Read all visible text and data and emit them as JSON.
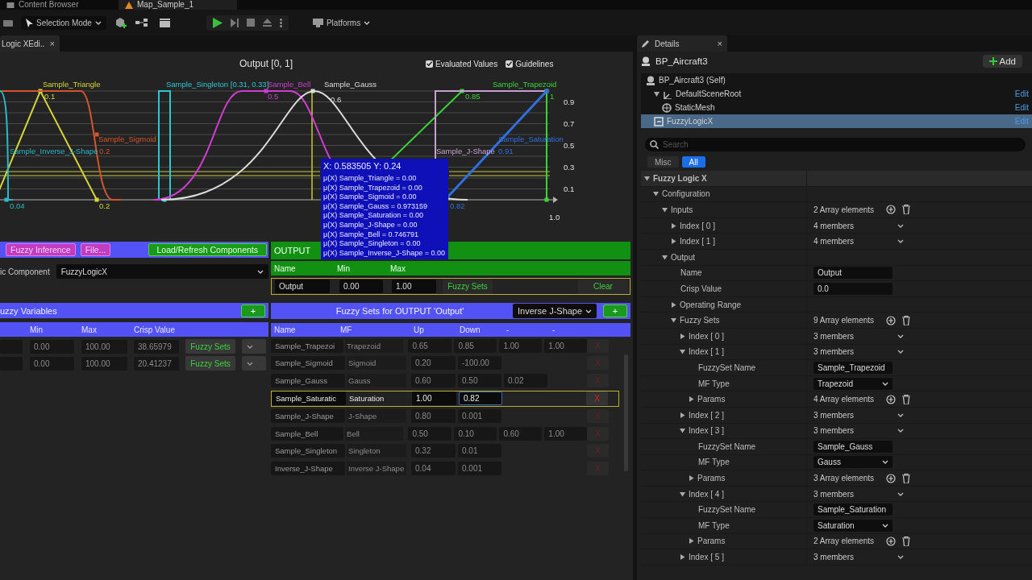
{
  "top_tabs": [
    {
      "label": "Content Browser",
      "selected": false
    },
    {
      "label": "Map_Sample_1",
      "selected": true
    }
  ],
  "toolbar": {
    "mode": "Selection Mode",
    "platforms": "Platforms"
  },
  "editor_tab": {
    "label": "Logic XEdi..",
    "close": "×"
  },
  "graph": {
    "title": "Output [0, 1]",
    "options": [
      {
        "label": "Evaluated Values",
        "checked": true
      },
      {
        "label": "Guidelines",
        "checked": true
      }
    ],
    "series": [
      {
        "name": "Sample_Triangle",
        "color": "#d4d43c",
        "marks": [
          "0.1",
          "0.2"
        ]
      },
      {
        "name": "Sample_Sigmoid",
        "color": "#d2552d",
        "marks": [
          "0.2"
        ]
      },
      {
        "name": "Sample_Inverse_J-Shape",
        "color": "#2cb8c8",
        "marks": [
          "0.04"
        ]
      },
      {
        "name": "Sample_Singleton [0.31, 0.33]",
        "color": "#2cc8d0"
      },
      {
        "name": "Sample_Bell",
        "color": "#d03cd0",
        "marks": [
          "0.5"
        ]
      },
      {
        "name": "Sample_Gauss",
        "color": "#dcdcdc",
        "marks": [
          "0.6"
        ]
      },
      {
        "name": "Sample_Trapezoid",
        "color": "#3cd23c",
        "marks": [
          "0.85",
          "1"
        ]
      },
      {
        "name": "Sample_J-Shape",
        "color": "#c8a0d0"
      },
      {
        "name": "Sample_Saturation",
        "color": "#2f6fe0",
        "marks": [
          "0.91",
          "0.82"
        ]
      }
    ],
    "yticks": [
      "0.9",
      "0.7",
      "0.5",
      "0.3",
      "0.1"
    ],
    "x_end": "1.0",
    "readout": {
      "position": "X: 0.583505 Y: 0.24",
      "lines": [
        "μ(X) Sample_Triangle = 0.00",
        "μ(X) Sample_Trapezoid = 0.00",
        "μ(X) Sample_Sigmoid = 0.00",
        "μ(X) Sample_Gauss = 0.973159",
        "μ(X) Sample_Saturation = 0.00",
        "μ(X) Sample_J-Shape = 0.00",
        "μ(X) Sample_Bell = 0.746791",
        "μ(X) Sample_Singleton = 0.00",
        "μ(X) Sample_Inverse_J-Shape = 0.00"
      ]
    }
  },
  "logic_bar": {
    "buttons": [
      {
        "label": "Fuzzy Inference",
        "kind": "menu"
      },
      {
        "label": "File...",
        "kind": "menu"
      },
      {
        "label": "Load/Refresh Components",
        "kind": "action"
      }
    ]
  },
  "component": {
    "label": "ic Component",
    "value": "FuzzyLogicX"
  },
  "variables": {
    "title": "uzzy Variables",
    "add": "+",
    "columns": [
      "Min",
      "Max",
      "Crisp Value"
    ],
    "rows": [
      {
        "min": "0.00",
        "max": "100.00",
        "crisp": "38.65979",
        "button": "Fuzzy Sets"
      },
      {
        "min": "0.00",
        "max": "100.00",
        "crisp": "20.41237",
        "button": "Fuzzy Sets"
      }
    ]
  },
  "output": {
    "title": "OUTPUT",
    "columns": [
      "Name",
      "Min",
      "Max"
    ],
    "name": "Output",
    "min": "0.00",
    "max": "1.00",
    "sets_button": "Fuzzy Sets",
    "clear_button": "Clear"
  },
  "fuzzy_sets": {
    "title": "Fuzzy Sets for OUTPUT 'Output'",
    "mf_choice": "Inverse J-Shape",
    "add": "+",
    "columns": [
      "Name",
      "MF",
      "Up",
      "Down",
      "-",
      "-"
    ],
    "rows": [
      {
        "name": "Sample_Trapezoi",
        "mf": "Trapezoid",
        "params": [
          "0.65",
          "0.85",
          "1.00",
          "1.00"
        ],
        "selected": false,
        "delete": "X"
      },
      {
        "name": "Sample_Sigmoid",
        "mf": "Sigmoid",
        "params": [
          "0.20",
          "-100.00"
        ],
        "selected": false,
        "delete": "X"
      },
      {
        "name": "Sample_Gauss",
        "mf": "Gauss",
        "params": [
          "0.60",
          "0.50",
          "0.02"
        ],
        "selected": false,
        "delete": "X"
      },
      {
        "name": "Sample_Saturatic",
        "mf": "Saturation",
        "params": [
          "1.00",
          "0.82"
        ],
        "selected": true,
        "delete": "X"
      },
      {
        "name": "Sample_J-Shape",
        "mf": "J-Shape",
        "params": [
          "0.80",
          "0.001"
        ],
        "selected": false,
        "delete": "X"
      },
      {
        "name": "Sample_Bell",
        "mf": "Bell",
        "params": [
          "0.50",
          "0.10",
          "0.60",
          "1.00"
        ],
        "selected": false,
        "delete": "X"
      },
      {
        "name": "Sample_Singleton",
        "mf": "Singleton",
        "params": [
          "0.32",
          "0.01"
        ],
        "selected": false,
        "delete": "X"
      },
      {
        "name": "Inverse_J-Shape",
        "mf": "Inverse J-Shape",
        "params": [
          "0.04",
          "0.001"
        ],
        "selected": false,
        "delete": "X"
      }
    ]
  },
  "details": {
    "tab": "Details",
    "close": "×",
    "actor": "BP_Aircraft3",
    "add_button": "Add",
    "components": [
      {
        "label": "BP_Aircraft3 (Self)",
        "kind": "actor",
        "selected": false,
        "children": [
          {
            "label": "DefaultSceneRoot",
            "kind": "scene",
            "link": "Edit",
            "selected": false,
            "children": [
              {
                "label": "StaticMesh",
                "kind": "mesh",
                "link": "Edit",
                "selected": false
              }
            ]
          },
          {
            "label": "FuzzyLogicX",
            "kind": "component",
            "link": "Edit",
            "selected": true
          }
        ]
      }
    ],
    "search": {
      "placeholder": "Search"
    },
    "filters": [
      {
        "label": "Misc",
        "selected": false
      },
      {
        "label": "All",
        "selected": true
      }
    ],
    "properties": [
      {
        "label": "Fuzzy Logic X",
        "kind": "category",
        "expanded": true,
        "children": [
          {
            "label": "Configuration",
            "expanded": true,
            "children": [
              {
                "label": "Inputs",
                "kind": "array",
                "value": "2 Array elements",
                "expanded": true,
                "children": [
                  {
                    "label": "Index [ 0 ]",
                    "kind": "struct",
                    "value": "4 members",
                    "expanded": false
                  },
                  {
                    "label": "Index [ 1 ]",
                    "kind": "struct",
                    "value": "4 members",
                    "expanded": false
                  }
                ]
              },
              {
                "label": "Output",
                "expanded": true,
                "children": [
                  {
                    "label": "Name",
                    "kind": "field",
                    "value": "Output"
                  },
                  {
                    "label": "Crisp Value",
                    "kind": "field",
                    "value": "0.0"
                  },
                  {
                    "label": "Operating Range",
                    "expanded": false
                  },
                  {
                    "label": "Fuzzy Sets",
                    "kind": "array",
                    "value": "9 Array elements",
                    "expanded": true,
                    "children": [
                      {
                        "label": "Index [ 0 ]",
                        "kind": "struct",
                        "value": "3 members",
                        "expanded": false
                      },
                      {
                        "label": "Index [ 1 ]",
                        "kind": "struct",
                        "value": "3 members",
                        "expanded": true,
                        "children": [
                          {
                            "label": "FuzzySet Name",
                            "kind": "field",
                            "value": "Sample_Trapezoid"
                          },
                          {
                            "label": "MF Type",
                            "kind": "dropdown",
                            "value": "Trapezoid"
                          },
                          {
                            "label": "Params",
                            "kind": "array",
                            "value": "4 Array elements",
                            "expanded": false
                          }
                        ]
                      },
                      {
                        "label": "Index [ 2 ]",
                        "kind": "struct",
                        "value": "3 members",
                        "expanded": false
                      },
                      {
                        "label": "Index [ 3 ]",
                        "kind": "struct",
                        "value": "3 members",
                        "expanded": true,
                        "children": [
                          {
                            "label": "FuzzySet Name",
                            "kind": "field",
                            "value": "Sample_Gauss"
                          },
                          {
                            "label": "MF Type",
                            "kind": "dropdown",
                            "value": "Gauss"
                          },
                          {
                            "label": "Params",
                            "kind": "array",
                            "value": "3 Array elements",
                            "expanded": false
                          }
                        ]
                      },
                      {
                        "label": "Index [ 4 ]",
                        "kind": "struct",
                        "value": "3 members",
                        "expanded": true,
                        "children": [
                          {
                            "label": "FuzzySet Name",
                            "kind": "field",
                            "value": "Sample_Saturation"
                          },
                          {
                            "label": "MF Type",
                            "kind": "dropdown",
                            "value": "Saturation"
                          },
                          {
                            "label": "Params",
                            "kind": "array",
                            "value": "2 Array elements",
                            "expanded": false
                          }
                        ]
                      },
                      {
                        "label": "Index [ 5 ]",
                        "kind": "struct",
                        "value": "3 members",
                        "expanded": false
                      }
                    ]
                  }
                ]
              }
            ]
          }
        ]
      }
    ]
  }
}
